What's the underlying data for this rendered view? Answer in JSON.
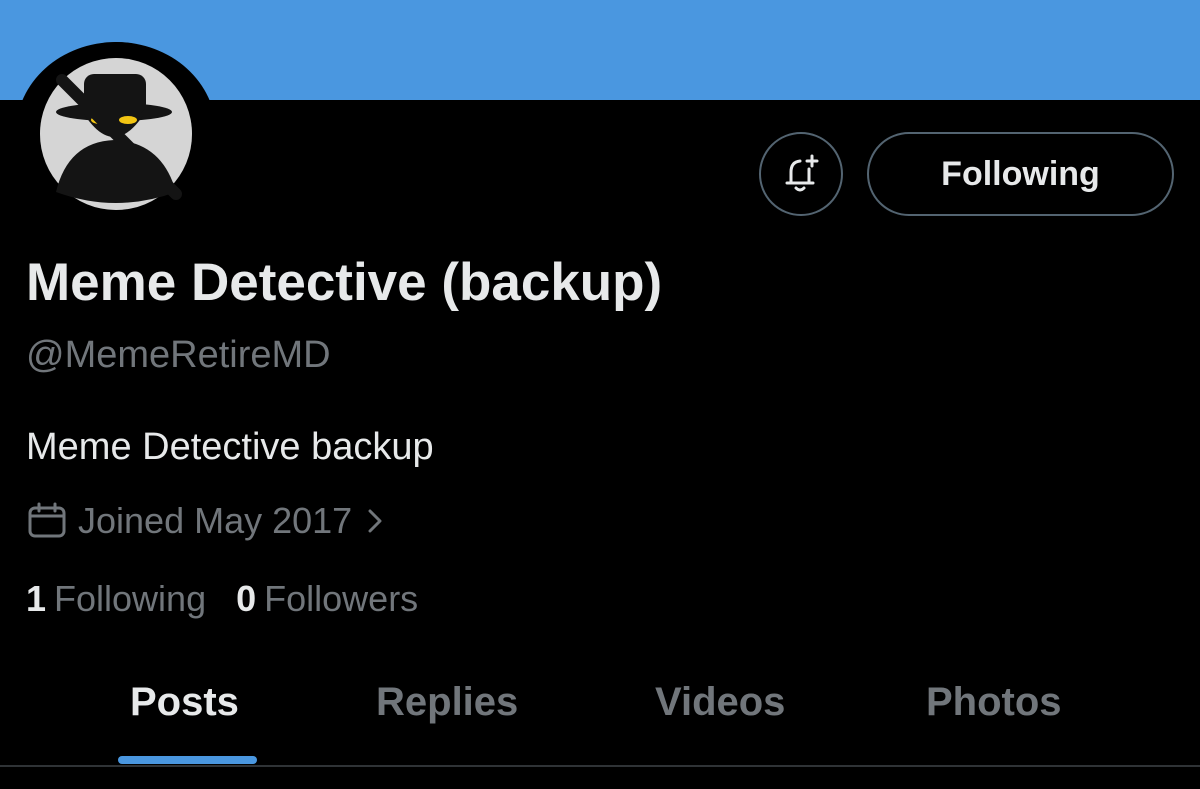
{
  "profile": {
    "display_name": "Meme Detective (backup)",
    "handle": "@MemeRetireMD",
    "bio": "Meme Detective backup",
    "joined": "Joined May 2017",
    "following_count": "1",
    "following_label": "Following",
    "followers_count": "0",
    "followers_label": "Followers"
  },
  "actions": {
    "bell_icon": "bell-plus-icon",
    "following_button_label": "Following"
  },
  "tabs": [
    {
      "label": "Posts",
      "active": true
    },
    {
      "label": "Replies",
      "active": false
    },
    {
      "label": "Videos",
      "active": false
    },
    {
      "label": "Photos",
      "active": false
    }
  ],
  "colors": {
    "banner": "#4a97e0",
    "background": "#000000",
    "primary_text": "#e7e9ea",
    "secondary_text": "#71767b",
    "accent": "#4a97e0",
    "border": "#536471"
  }
}
